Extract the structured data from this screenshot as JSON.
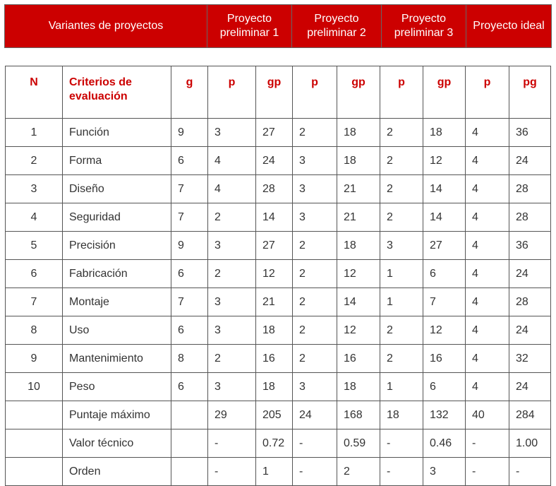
{
  "header_row": {
    "variants_label": "Variantes de proyectos",
    "project_1": "Proyecto preliminar 1",
    "project_2": "Proyecto preliminar 2",
    "project_3": "Proyecto preliminar 3",
    "project_ideal": "Proyecto ideal"
  },
  "columns": [
    "N",
    "Criterios de evaluación",
    "g",
    "p",
    "gp",
    "p",
    "gp",
    "p",
    "gp",
    "p",
    "pg"
  ],
  "rows": [
    [
      "1",
      "Función",
      "9",
      "3",
      "27",
      "2",
      "18",
      "2",
      "18",
      "4",
      "36"
    ],
    [
      "2",
      "Forma",
      "6",
      "4",
      "24",
      "3",
      "18",
      "2",
      "12",
      "4",
      "24"
    ],
    [
      "3",
      "Diseño",
      "7",
      "4",
      "28",
      "3",
      "21",
      "2",
      "14",
      "4",
      "28"
    ],
    [
      "4",
      "Seguridad",
      "7",
      "2",
      "14",
      "3",
      "21",
      "2",
      "14",
      "4",
      "28"
    ],
    [
      "5",
      "Precisión",
      "9",
      "3",
      "27",
      "2",
      "18",
      "3",
      "27",
      "4",
      "36"
    ],
    [
      "6",
      "Fabricación",
      "6",
      "2",
      "12",
      "2",
      "12",
      "1",
      "6",
      "4",
      "24"
    ],
    [
      "7",
      "Montaje",
      "7",
      "3",
      "21",
      "2",
      "14",
      "1",
      "7",
      "4",
      "28"
    ],
    [
      "8",
      "Uso",
      "6",
      "3",
      "18",
      "2",
      "12",
      "2",
      "12",
      "4",
      "24"
    ],
    [
      "9",
      "Mantenimiento",
      "8",
      "2",
      "16",
      "2",
      "16",
      "2",
      "16",
      "4",
      "32"
    ],
    [
      "10",
      "Peso",
      "6",
      "3",
      "18",
      "3",
      "18",
      "1",
      "6",
      "4",
      "24"
    ],
    [
      "",
      "Puntaje máximo",
      "",
      "29",
      "205",
      "24",
      "168",
      "18",
      "132",
      "40",
      "284"
    ],
    [
      "",
      "Valor técnico",
      "",
      "-",
      "0.72",
      "-",
      "0.59",
      "-",
      "0.46",
      "-",
      "1.00"
    ],
    [
      "",
      "Orden",
      "",
      "-",
      "1",
      "-",
      "2",
      "-",
      "3",
      "-",
      "-"
    ]
  ]
}
